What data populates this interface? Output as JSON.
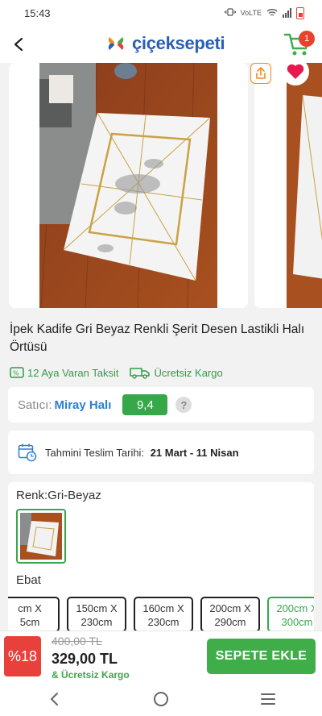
{
  "status_bar": {
    "time": "15:43",
    "network": "VoLTE"
  },
  "header": {
    "logo_text": "çiçeksepeti",
    "cart_count": "1"
  },
  "product": {
    "title": "İpek Kadife Gri Beyaz Renkli Şerit Desen Lastikli Halı Örtüsü",
    "installment": "12 Aya Varan Taksit",
    "free_shipping": "Ücretsiz Kargo"
  },
  "seller": {
    "label": "Satıcı:",
    "name": "Miray Halı",
    "score": "9,4",
    "help": "?"
  },
  "delivery": {
    "label": "Tahmini Teslim Tarihi:",
    "value": "21 Mart - 11 Nisan"
  },
  "options": {
    "color_label": "Renk:Gri-Beyaz",
    "size_label": "Ebat",
    "sizes": [
      {
        "line1": "cm X",
        "line2": "5cm"
      },
      {
        "line1": "150cm X",
        "line2": "230cm"
      },
      {
        "line1": "160cm X",
        "line2": "230cm"
      },
      {
        "line1": "200cm X",
        "line2": "290cm"
      },
      {
        "line1": "200cm X",
        "line2": "300cm"
      }
    ]
  },
  "pricing": {
    "discount": "%18",
    "old_price": "400,00 TL",
    "new_price": "329,00 TL",
    "shipping_note": "& Ücretsiz Kargo",
    "add_to_cart": "SEPETE EKLE"
  },
  "colors": {
    "brand_green": "#3fae49",
    "brand_blue": "#2b5fb4",
    "discount_red": "#e8413c"
  }
}
